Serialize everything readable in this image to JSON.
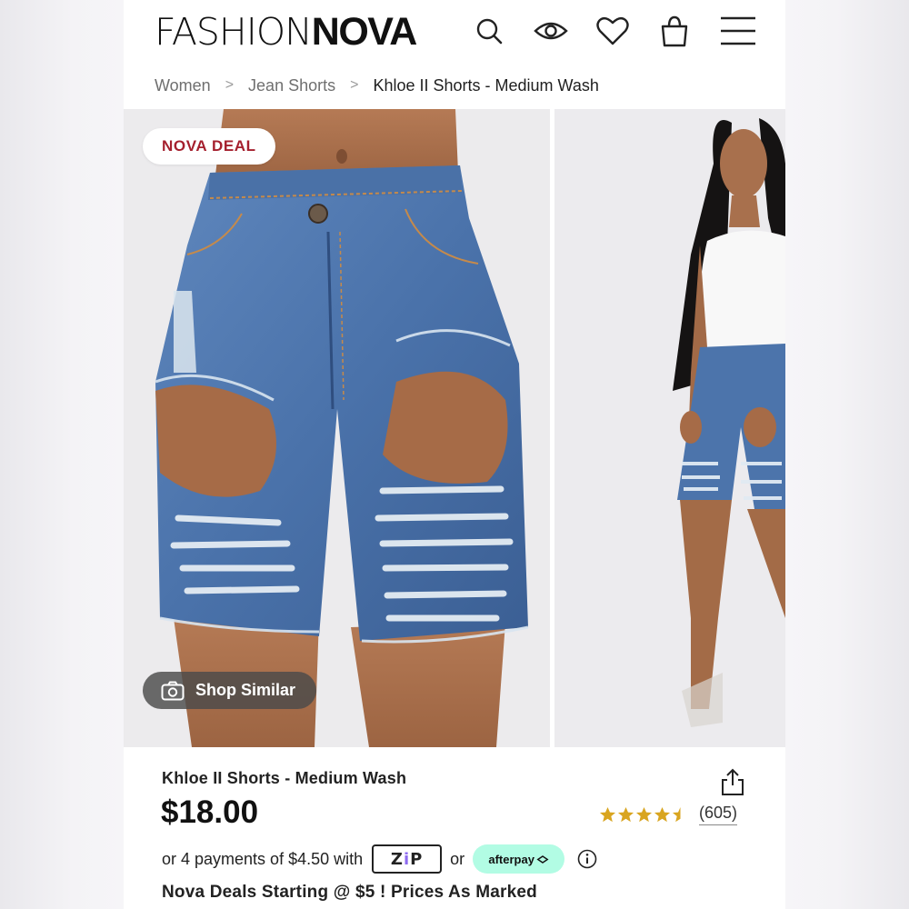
{
  "header": {
    "logo_light": "FASHION",
    "logo_bold": "NOVA",
    "icons": [
      "search-icon",
      "eye-icon",
      "heart-icon",
      "shopping-bag-icon",
      "hamburger-menu-icon"
    ]
  },
  "breadcrumb": {
    "items": [
      "Women",
      "Jean Shorts",
      "Khloe II Shorts - Medium Wash"
    ],
    "separator": ">"
  },
  "gallery": {
    "badge": "NOVA DEAL",
    "shop_similar_label": "Shop Similar",
    "badge_color": "#a5202e"
  },
  "product": {
    "name": "Khloe II Shorts - Medium Wash",
    "price": "$18.00",
    "rating": 4.5,
    "review_count": "(605)",
    "star_color": "#d9a520"
  },
  "payment": {
    "prefix": "or 4 payments of $4.50 with",
    "zip_label_left": "Z",
    "zip_label_mid": "i",
    "zip_label_right": "P",
    "or_label": "or",
    "afterpay_label": "afterpay",
    "afterpay_color": "#b2fce4"
  },
  "promo": {
    "text": "Nova Deals Starting @ $5 ! Prices As Marked"
  }
}
